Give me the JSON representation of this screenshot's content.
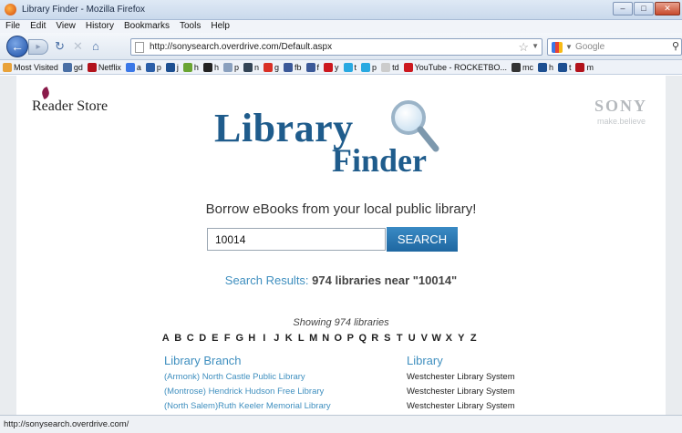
{
  "window": {
    "title": "Library Finder - Mozilla Firefox"
  },
  "menu": [
    "File",
    "Edit",
    "View",
    "History",
    "Bookmarks",
    "Tools",
    "Help"
  ],
  "nav": {
    "url": "http://sonysearch.overdrive.com/Default.aspx",
    "search_placeholder": "Google"
  },
  "bookmarks": [
    {
      "label": "Most Visited",
      "color": "#e8a23a"
    },
    {
      "label": "gd",
      "color": "#4a6fa5"
    },
    {
      "label": "Netflix",
      "color": "#b2121b"
    },
    {
      "label": "a",
      "color": "#3b78e7"
    },
    {
      "label": "p",
      "color": "#2c5fa8"
    },
    {
      "label": "j",
      "color": "#1d4f91"
    },
    {
      "label": "h",
      "color": "#6aa533"
    },
    {
      "label": "h",
      "color": "#222222"
    },
    {
      "label": "p",
      "color": "#8aa0be"
    },
    {
      "label": "n",
      "color": "#334455"
    },
    {
      "label": "g",
      "color": "#d93025"
    },
    {
      "label": "fb",
      "color": "#3b5998"
    },
    {
      "label": "f",
      "color": "#3b5998"
    },
    {
      "label": "y",
      "color": "#cc181e"
    },
    {
      "label": "t",
      "color": "#29a9e1"
    },
    {
      "label": "p",
      "color": "#29a9e1"
    },
    {
      "label": "td",
      "color": "#cccccc"
    },
    {
      "label": "YouTube - ROCKETBO...",
      "color": "#cc181e"
    },
    {
      "label": "mc",
      "color": "#333333"
    },
    {
      "label": "h",
      "color": "#1d4f91"
    },
    {
      "label": "t",
      "color": "#1d4f91"
    },
    {
      "label": "m",
      "color": "#b2121b"
    }
  ],
  "header": {
    "reader_store": "Reader Store",
    "sony": "SONY",
    "sony_tag": "make.believe",
    "logo_library": "Library",
    "logo_finder": "Finder"
  },
  "search": {
    "tagline": "Borrow eBooks from your local public library!",
    "zip_value": "10014",
    "button_label": "SEARCH"
  },
  "results": {
    "label": "Search Results:",
    "value": "974 libraries near \"10014\""
  },
  "listing": {
    "showing": "Showing 974 libraries",
    "alphabet": [
      "A",
      "B",
      "C",
      "D",
      "E",
      "F",
      "G",
      "H",
      "I",
      "J",
      "K",
      "L",
      "M",
      "N",
      "O",
      "P",
      "Q",
      "R",
      "S",
      "T",
      "U",
      "V",
      "W",
      "X",
      "Y",
      "Z"
    ],
    "col_branch": "Library Branch",
    "col_library": "Library",
    "rows": [
      {
        "branch": "(Armonk) North Castle Public Library",
        "library": "Westchester Library System"
      },
      {
        "branch": "(Montrose) Hendrick Hudson Free Library",
        "library": "Westchester Library System"
      },
      {
        "branch": "(North Salem)Ruth Keeler Memorial Library",
        "library": "Westchester Library System"
      }
    ]
  },
  "status": {
    "text": "http://sonysearch.overdrive.com/"
  }
}
